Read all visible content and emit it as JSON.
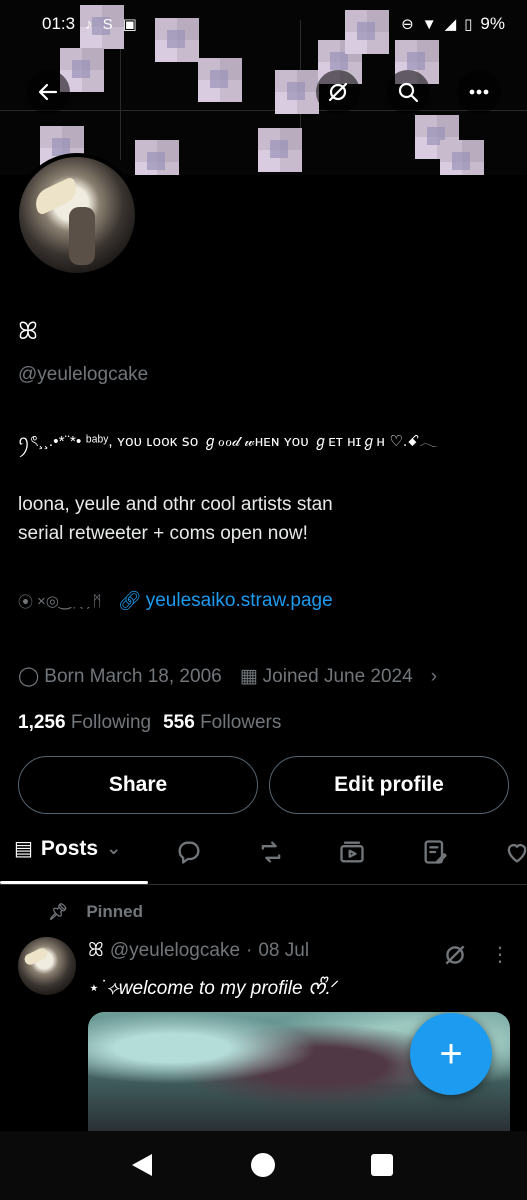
{
  "status_bar": {
    "time": "01:3",
    "battery": "9%",
    "left_icons": [
      "tiktok-icon",
      "snapchat-icon",
      "notification-icon"
    ],
    "right_icons": [
      "dnd-icon",
      "wifi-icon",
      "signal-icon",
      "battery-icon"
    ]
  },
  "profile": {
    "display_name": "ꕤ",
    "handle": "@yeulelogcake",
    "bio_fancy": "ꪆৎ¸¸.•*¨*• ᵇᵃᵇʸ, ʏᴏᴜ ʟᴏᴏᴋ ꜱᴏ ℊℴℴ𝒹 𝓌ʜᴇɴ ʏᴏᴜ ℊᴇᴛ ʜɪℊʜ ♡.ꗃ𓂃",
    "bio_lines": [
      "loona, yeule and othr cool artists stan",
      "serial retweeter + coms open now!"
    ],
    "location": "×◎‿ ̣ ̣ˎ ̗ ᛗ",
    "link": "yeulesaiko.straw.page",
    "born": "Born March 18, 2006",
    "joined": "Joined June 2024",
    "following_count": "1,256",
    "following_label": "Following",
    "followers_count": "556",
    "followers_label": "Followers"
  },
  "buttons": {
    "share": "Share",
    "edit_profile": "Edit profile"
  },
  "tabs": {
    "posts": "Posts"
  },
  "post": {
    "pinned_label": "Pinned",
    "author_name": "ꕤ",
    "author_handle": "@yeulelogcake",
    "separator": "·",
    "date": "08 Jul",
    "text": "⋆˙⟡welcome to my profile ᰔᩚ.ᐟ"
  },
  "colors": {
    "accent": "#1d9bf0",
    "muted": "#71767b",
    "border": "#536471"
  }
}
